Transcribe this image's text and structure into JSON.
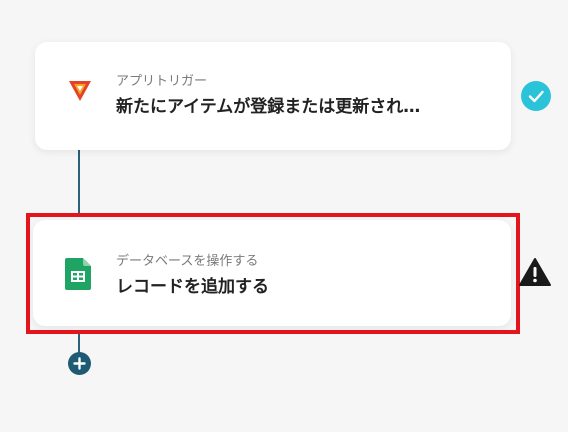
{
  "flow": {
    "trigger": {
      "category": "アプリトリガー",
      "title": "新たにアイテムが登録または更新され…",
      "icon": "app-logo-icon",
      "status_icon": "check-icon"
    },
    "action": {
      "category": "データベースを操作する",
      "title": "レコードを追加する",
      "icon": "spreadsheet-icon",
      "status_icon": "warning-icon"
    },
    "add_icon": "plus-icon"
  },
  "colors": {
    "background": "#f6f6f7",
    "connector": "#2a6079",
    "add_button": "#1e5b73",
    "check": "#2bc3d8",
    "highlight": "#e3141b",
    "warning": "#1a1a1a",
    "sheets_green": "#1fa463",
    "logo_red": "#e4412b",
    "logo_orange": "#f7a21b"
  }
}
